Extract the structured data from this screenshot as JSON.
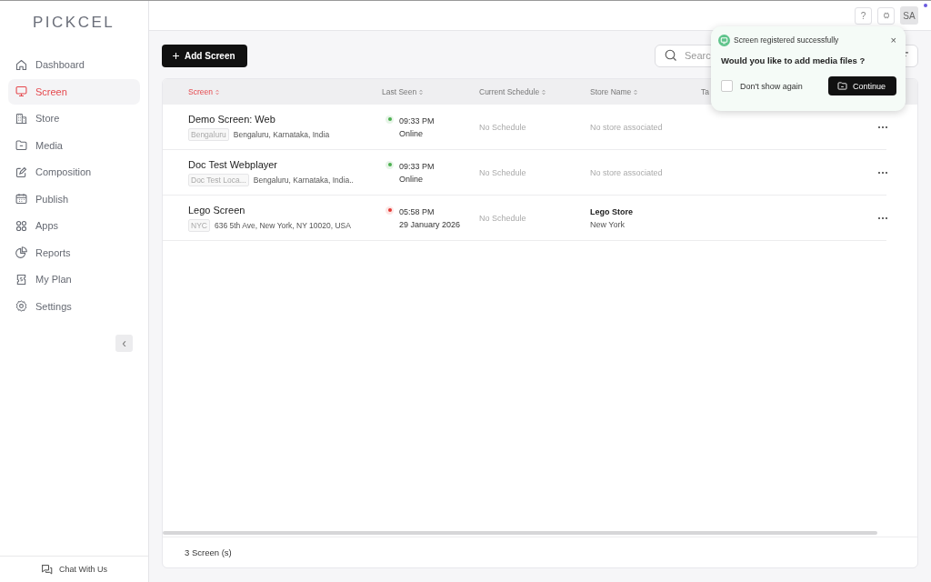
{
  "sidebar": {
    "logo": "PICKCEL",
    "items": [
      {
        "label": "Dashboard",
        "selected": false
      },
      {
        "label": "Screen",
        "selected": true
      },
      {
        "label": "Store",
        "selected": false
      },
      {
        "label": "Media",
        "selected": false
      },
      {
        "label": "Composition",
        "selected": false
      },
      {
        "label": "Publish",
        "selected": false
      },
      {
        "label": "Apps",
        "selected": false
      },
      {
        "label": "Reports",
        "selected": false
      },
      {
        "label": "My Plan",
        "selected": false
      },
      {
        "label": "Settings",
        "selected": false
      }
    ],
    "collapse": "‹",
    "chat": "Chat With Us"
  },
  "topbar": {
    "help": "?",
    "avatar": "SA"
  },
  "toolbar": {
    "add_button": "Add Screen",
    "search": {
      "placeholder": "Searc"
    }
  },
  "table": {
    "columns": [
      {
        "label": "Screen",
        "selected": true
      },
      {
        "label": "Last Seen",
        "selected": false
      },
      {
        "label": "Current Schedule",
        "selected": false
      },
      {
        "label": "Store Name",
        "selected": false
      },
      {
        "label": "Ta",
        "selected": false
      }
    ],
    "rows": [
      {
        "name": "Demo Screen: Web",
        "tag": "Bengaluru",
        "address": "Bengaluru, Karnataka, India",
        "color": "#4caf50",
        "time": "09:33 PM",
        "status": "Online",
        "schedule": "No Schedule",
        "store": {
          "kind": "empty",
          "text": "No store associated"
        }
      },
      {
        "name": "Doc Test Webplayer",
        "tag": "Doc Test Loca...",
        "address": "Bengaluru, Karnataka, India..",
        "color": "#4caf50",
        "time": "09:33 PM",
        "status": "Online",
        "schedule": "No Schedule",
        "store": {
          "kind": "empty",
          "text": "No store associated"
        }
      },
      {
        "name": "Lego Screen",
        "tag": "NYC",
        "address": "636 5th Ave, New York, NY 10020, USA",
        "color": "#e53935",
        "time": "05:58 PM",
        "status": "29 January 2026",
        "schedule": "No Schedule",
        "store": {
          "kind": "store",
          "name": "Lego Store",
          "city": "New York"
        }
      }
    ],
    "footer": "3 Screen (s)"
  },
  "toast": {
    "title": "Screen registered successfully",
    "close": "×",
    "question": "Would you like to add media files ?",
    "checkbox": {
      "label": "Don't show again",
      "checked": false
    },
    "button": "Continue"
  }
}
